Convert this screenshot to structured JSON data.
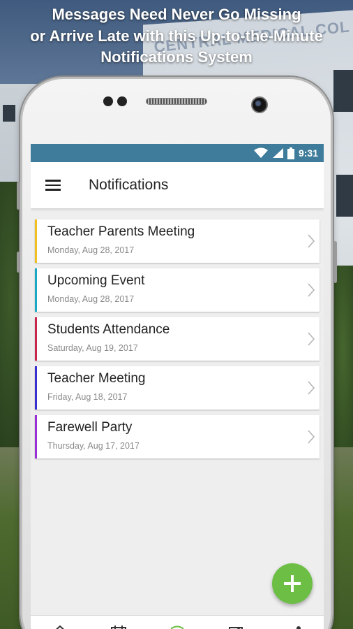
{
  "headline": {
    "line1": "Messages Need Never Go Missing",
    "line2": "or Arrive Late with this Up-to-the-Minute",
    "line3": "Notifications System"
  },
  "background": {
    "sign_text": "CENTRAL MEDICAL COL"
  },
  "status_bar": {
    "time": "9:31",
    "color": "#3f7c9b"
  },
  "app_bar": {
    "title": "Notifications",
    "menu_icon": "hamburger-menu-icon"
  },
  "notifications": [
    {
      "title": "Teacher Parents Meeting",
      "date": "Monday, Aug 28, 2017",
      "color": "#f2c01e"
    },
    {
      "title": "Upcoming Event",
      "date": "Monday, Aug 28, 2017",
      "color": "#1aa9c4"
    },
    {
      "title": "Students Attendance",
      "date": "Saturday, Aug 19, 2017",
      "color": "#c8254f"
    },
    {
      "title": "Teacher Meeting",
      "date": "Friday, Aug 18, 2017",
      "color": "#3b2fd0"
    },
    {
      "title": "Farewell Party",
      "date": "Thursday, Aug 17, 2017",
      "color": "#9a2fd6"
    }
  ],
  "fab": {
    "icon": "plus-icon",
    "color": "#6cbe45"
  },
  "bottom_nav": {
    "items": [
      {
        "icon": "home-icon"
      },
      {
        "icon": "calendar-icon"
      },
      {
        "icon": "shield-icon",
        "color": "#6cbe45"
      },
      {
        "icon": "document-icon"
      },
      {
        "icon": "share-icon"
      }
    ]
  }
}
